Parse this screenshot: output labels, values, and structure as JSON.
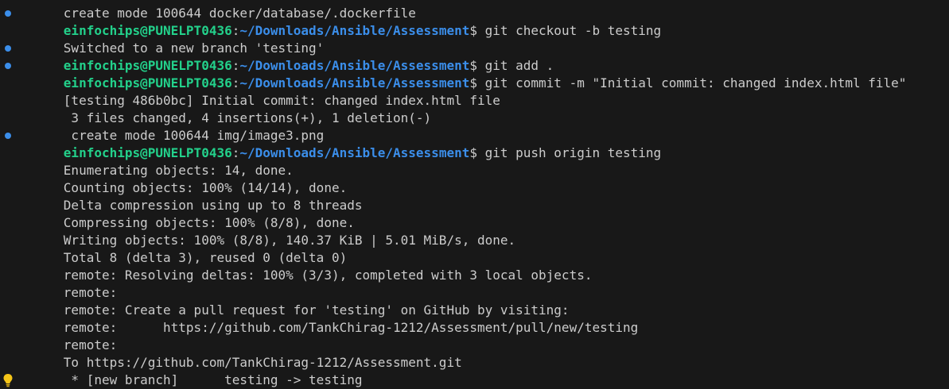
{
  "prompt": {
    "user": "einfochips@PUNELPT0436",
    "sep": ":",
    "path": "~/Downloads/Ansible/Assessment",
    "symbol": "$ "
  },
  "lines": {
    "l0": "create mode 100644 docker/database/.dockerfile",
    "c1": "git checkout -b testing",
    "o2": "Switched to a new branch 'testing'",
    "c3": "git add .",
    "c4": "git commit -m \"Initial commit: changed index.html file\"",
    "o5": "[testing 486b0bc] Initial commit: changed index.html file",
    "o6": " 3 files changed, 4 insertions(+), 1 deletion(-)",
    "o7": " create mode 100644 img/image3.png",
    "c8": "git push origin testing",
    "o9": "Enumerating objects: 14, done.",
    "o10": "Counting objects: 100% (14/14), done.",
    "o11": "Delta compression using up to 8 threads",
    "o12": "Compressing objects: 100% (8/8), done.",
    "o13": "Writing objects: 100% (8/8), 140.37 KiB | 5.01 MiB/s, done.",
    "o14": "Total 8 (delta 3), reused 0 (delta 0)",
    "o15": "remote: Resolving deltas: 100% (3/3), completed with 3 local objects.",
    "o16": "remote:",
    "o17": "remote: Create a pull request for 'testing' on GitHub by visiting:",
    "o18": "remote:      https://github.com/TankChirag-1212/Assessment/pull/new/testing",
    "o19": "remote:",
    "o20": "To https://github.com/TankChirag-1212/Assessment.git",
    "o21": " * [new branch]      testing -> testing"
  },
  "icons": {
    "decoration": "command-success-dot-icon",
    "suggestion": "lightbulb-icon"
  },
  "colors": {
    "background": "#181818",
    "text": "#cccccc",
    "user": "#23d18b",
    "path": "#3b8eea",
    "decoration": "#3b8eea",
    "bulb": "#f5c518"
  }
}
